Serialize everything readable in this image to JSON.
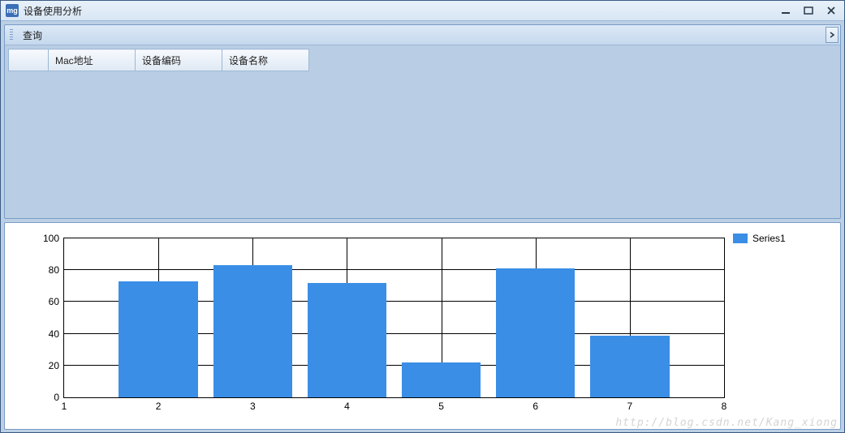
{
  "window": {
    "title": "设备使用分析",
    "app_icon_text": "mg"
  },
  "toolbar": {
    "query_label": "查询"
  },
  "grid": {
    "columns": [
      "Mac地址",
      "设备编码",
      "设备名称"
    ]
  },
  "legend": {
    "series1": "Series1"
  },
  "watermark": "http://blog.csdn.net/Kang_xiong",
  "chart_data": {
    "type": "bar",
    "series": [
      {
        "name": "Series1",
        "color": "#3a8ee6",
        "x": [
          2,
          3,
          4,
          5,
          6,
          7
        ],
        "values": [
          73,
          83,
          72,
          22,
          81,
          39
        ]
      }
    ],
    "xlabel": "",
    "ylabel": "",
    "xlim": [
      1,
      8
    ],
    "ylim": [
      0,
      100
    ],
    "xticks": [
      1,
      2,
      3,
      4,
      5,
      6,
      7,
      8
    ],
    "yticks": [
      0,
      20,
      40,
      60,
      80,
      100
    ],
    "grid": true,
    "legend_position": "right"
  }
}
